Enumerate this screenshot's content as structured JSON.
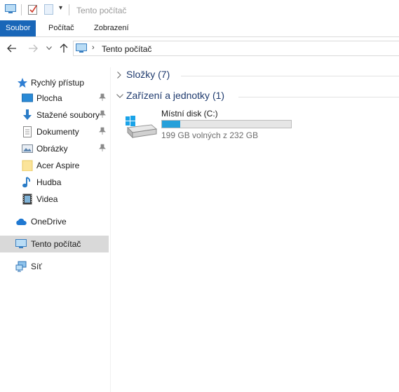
{
  "window": {
    "title": "Tento počítač"
  },
  "ribbon": {
    "tabs": [
      "Soubor",
      "Počítač",
      "Zobrazení"
    ],
    "active_tab": "Soubor"
  },
  "address": {
    "path": "Tento počítač",
    "icon": "computer-icon"
  },
  "sidebar": {
    "quick_access": {
      "label": "Rychlý přístup",
      "icon": "star-icon"
    },
    "pinned": [
      {
        "label": "Plocha",
        "icon": "desktop-icon",
        "pinned": true
      },
      {
        "label": "Stažené soubory",
        "icon": "download-arrow-icon",
        "pinned": true
      },
      {
        "label": "Dokumenty",
        "icon": "document-icon",
        "pinned": true
      },
      {
        "label": "Obrázky",
        "icon": "pictures-icon",
        "pinned": true
      },
      {
        "label": "Acer Aspire",
        "icon": "folder-icon",
        "pinned": false
      },
      {
        "label": "Hudba",
        "icon": "music-note-icon",
        "pinned": false
      },
      {
        "label": "Videa",
        "icon": "film-icon",
        "pinned": false
      }
    ],
    "onedrive": {
      "label": "OneDrive",
      "icon": "cloud-icon"
    },
    "this_pc": {
      "label": "Tento počítač",
      "icon": "computer-icon",
      "selected": true
    },
    "network": {
      "label": "Síť",
      "icon": "network-icon"
    }
  },
  "main": {
    "groups": [
      {
        "label": "Složky (7)",
        "expanded": false
      },
      {
        "label": "Zařízení a jednotky (1)",
        "expanded": true
      }
    ],
    "drives": [
      {
        "name": "Místní disk (C:)",
        "free_text": "199 GB volných z 232 GB",
        "used_fraction": 0.142,
        "bar_color": "#26a0da"
      }
    ]
  },
  "colors": {
    "accent": "#1966b8",
    "selected_bg": "#d9d9d9",
    "group_text": "#1e3a6e"
  }
}
